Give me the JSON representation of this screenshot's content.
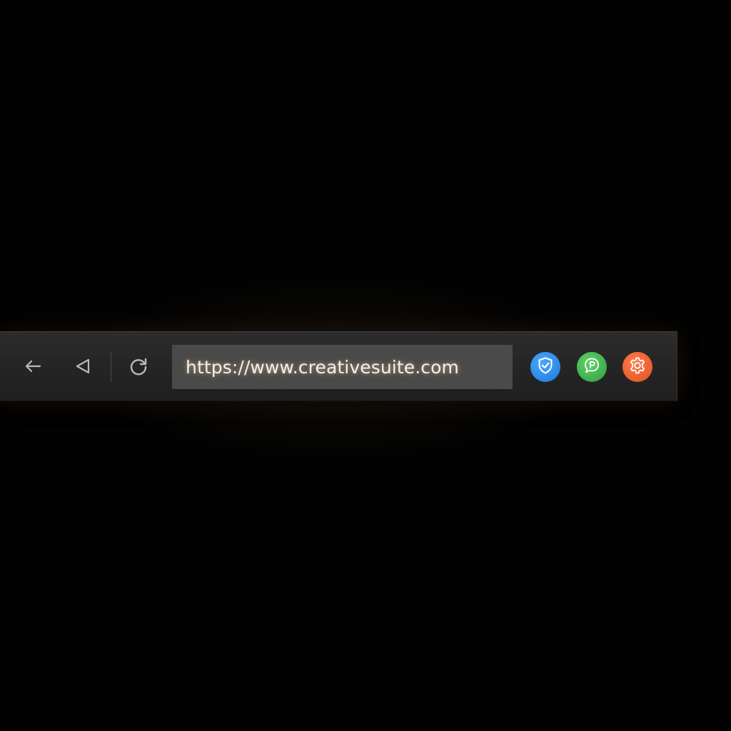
{
  "toolbar": {
    "url": "https://www.creativesuite.com"
  },
  "icons": {
    "back": "arrow-left-icon",
    "forward": "triangle-left-icon",
    "reload": "reload-icon",
    "shield": "shield-check-icon",
    "chat": "chat-bubble-icon",
    "gear": "gear-icon"
  },
  "colors": {
    "background": "#000000",
    "toolbar": "#262626",
    "address_bar": "#4a4a4a",
    "url_text": "#f3f0ec",
    "shield_extension": "#2a8cf0",
    "chat_extension": "#42b44e",
    "gear_extension": "#f06433"
  }
}
